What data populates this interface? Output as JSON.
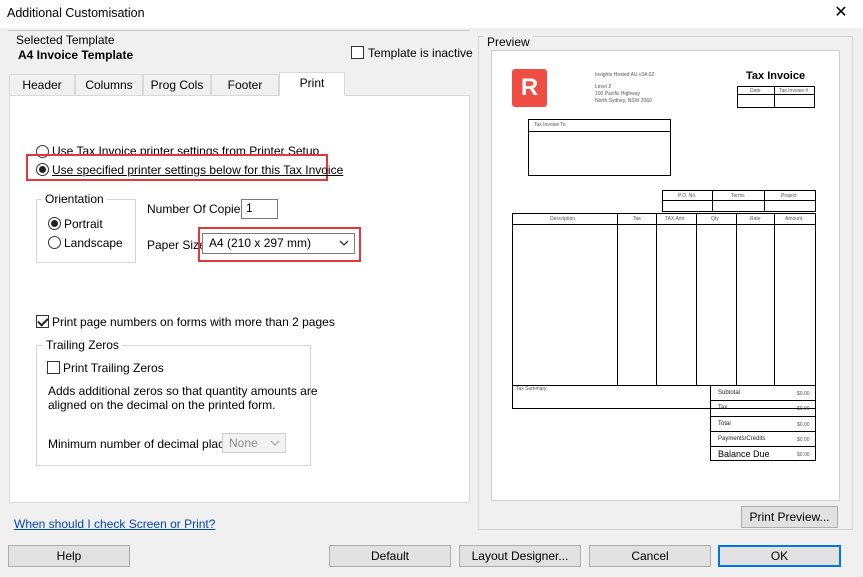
{
  "window": {
    "title": "Additional Customisation"
  },
  "selected_template": {
    "group_label": "Selected Template",
    "name": "A4 Invoice Template",
    "inactive_label": "Template is inactive",
    "inactive_checked": false
  },
  "tabs": [
    {
      "label": "Header"
    },
    {
      "label": "Columns"
    },
    {
      "label": "Prog Cols"
    },
    {
      "label": "Footer"
    },
    {
      "label": "Print",
      "active": true
    }
  ],
  "print": {
    "radio_printer_setup": "Use Tax Invoice printer settings from Printer Setup",
    "radio_specified": "Use specified printer settings below for this Tax Invoice",
    "orientation_title": "Orientation",
    "portrait": "Portrait",
    "landscape": "Landscape",
    "copies_label": "Number Of Copies",
    "copies_value": "1",
    "paper_size_label": "Paper Size",
    "paper_size_value": "A4 (210 x 297 mm)",
    "page_numbers_label": "Print page numbers on forms with more than 2 pages",
    "trailing_title": "Trailing Zeros",
    "print_trailing_label": "Print Trailing Zeros",
    "trailing_desc_1": "Adds additional zeros so that quantity amounts are",
    "trailing_desc_2": "aligned on the decimal on the printed form.",
    "min_decimal_label": "Minimum number of decimal places:",
    "min_decimal_value": "None"
  },
  "help_link": "When should I check Screen or Print?",
  "preview": {
    "group_label": "Preview",
    "logo_letter": "R",
    "company_line1": "Insights Hosted AU v3A 02",
    "company_line2": "Level 2",
    "company_line3": "100 Pacific Highway",
    "company_line4": "North Sydney, NSW 2060",
    "doc_title": "Tax Invoice",
    "date_label": "Date",
    "tax_invoice_no_label": "Tax Invoice #",
    "invoice_to_label": "Tax Invoice To",
    "po_label": "P.O. No.",
    "terms_label": "Terms",
    "project_label": "Project",
    "col_description": "Description",
    "col_tax": "Tax",
    "col_tax_amt": "TAX Amt",
    "col_qty": "Qty",
    "col_rate": "Rate",
    "col_amount": "Amount",
    "tax_summary_label": "Tax Summary",
    "subtotal": "Subtotal",
    "tax": "Tax",
    "total": "Total",
    "payments": "Payments/Credits",
    "balance_due": "Balance Due",
    "amount_zero": "$0.00"
  },
  "buttons": {
    "print_preview": "Print Preview...",
    "help": "Help",
    "default": "Default",
    "layout_designer": "Layout Designer...",
    "cancel": "Cancel",
    "ok": "OK"
  }
}
